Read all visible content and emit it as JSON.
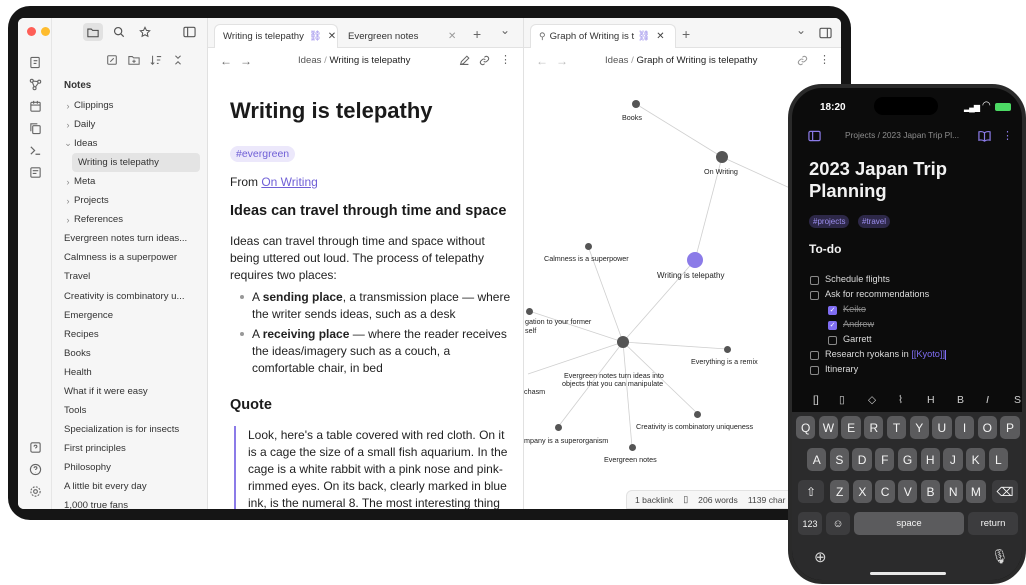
{
  "tablet": {
    "sidebar": {
      "section_title": "Notes",
      "items": [
        {
          "label": "Clippings",
          "chevron": "›"
        },
        {
          "label": "Daily",
          "chevron": "›"
        },
        {
          "label": "Ideas",
          "chevron": "⌄"
        },
        {
          "label": "Writing is telepathy",
          "chevron": ""
        },
        {
          "label": "Meta",
          "chevron": "›"
        },
        {
          "label": "Projects",
          "chevron": "›"
        },
        {
          "label": "References",
          "chevron": "›"
        },
        {
          "label": "Evergreen notes turn ideas...",
          "chevron": ""
        },
        {
          "label": "Calmness is a superpower",
          "chevron": ""
        },
        {
          "label": "Travel",
          "chevron": ""
        },
        {
          "label": "Creativity is combinatory u...",
          "chevron": ""
        },
        {
          "label": "Emergence",
          "chevron": ""
        },
        {
          "label": "Recipes",
          "chevron": ""
        },
        {
          "label": "Books",
          "chevron": ""
        },
        {
          "label": "Health",
          "chevron": ""
        },
        {
          "label": "What if it were easy",
          "chevron": ""
        },
        {
          "label": "Tools",
          "chevron": ""
        },
        {
          "label": "Specialization is for insects",
          "chevron": ""
        },
        {
          "label": "First principles",
          "chevron": ""
        },
        {
          "label": "Philosophy",
          "chevron": ""
        },
        {
          "label": "A little bit every day",
          "chevron": ""
        },
        {
          "label": "1,000 true fans",
          "chevron": ""
        }
      ]
    },
    "tabs": {
      "left": [
        {
          "label": "Writing is telepathy"
        },
        {
          "label": "Evergreen notes"
        }
      ],
      "right": [
        {
          "label": "Graph of Writing is t"
        }
      ],
      "add_symbol": "+",
      "chevron_symbol": "⌄",
      "close_symbol": "✕"
    },
    "note": {
      "breadcrumb_folder": "Ideas",
      "breadcrumb_sep": "/",
      "breadcrumb_title": "Writing is telepathy",
      "title": "Writing is telepathy",
      "tag": "#evergreen",
      "from_prefix": "From",
      "from_link": "On Writing",
      "heading1": "Ideas can travel through time and space",
      "para1_lines": [
        "Ideas can travel through time and space without",
        "being uttered out loud. The process of telepathy",
        "requires two places:"
      ],
      "bullets": [
        {
          "lead": "A",
          "bold": "sending place",
          "rest_lines": [
            ", a transmission place — where",
            "the writer sends ideas, such as a desk"
          ]
        },
        {
          "lead": "A",
          "bold": "receiving place",
          "rest_lines": [
            " — where the reader receives",
            "the ideas/imagery such as a couch, a",
            "comfortable chair, in bed"
          ]
        }
      ],
      "heading2": "Quote",
      "quote_lines": [
        "Look, here's a table covered with red cloth. On it",
        "is a cage the size of a small fish aquarium. In the",
        "cage is a white rabbit with a pink nose and pink-",
        "rimmed eyes. On its back, clearly marked in blue",
        "ink, is the numeral 8. The most interesting thing"
      ]
    },
    "graph": {
      "breadcrumb_folder": "Ideas",
      "breadcrumb_title": "Graph of Writing is telepathy",
      "nodes": {
        "books": "Books",
        "on_writing": "On Writing",
        "calmness": "Calmness is a superpower",
        "writing": "Writing is telepathy",
        "navigation": "gation to your former",
        "navigation2": "self",
        "evergreen_turn": "Evergreen notes turn ideas into",
        "evergreen_turn2": "objects that you can manipulate",
        "remix": "Everything is a remix",
        "chasm": "chasm",
        "creativity": "Creativity is combinatory uniqueness",
        "company": "mpany is a superorganism",
        "evergreen": "Evergreen notes"
      },
      "status": {
        "backlinks": "1 backlink",
        "words": "206 words",
        "chars": "1139 char"
      }
    }
  },
  "phone": {
    "time": "18:20",
    "breadcrumb": "Projects / 2023 Japan Trip Pl...",
    "title_lines": [
      "2023 Japan Trip",
      "Planning"
    ],
    "tags": [
      "#projects",
      "#travel"
    ],
    "section": "To-do",
    "todos": [
      {
        "label": "Schedule flights",
        "checked": false,
        "indent": 0,
        "strike": false
      },
      {
        "label": "Ask for recommendations",
        "checked": false,
        "indent": 0,
        "strike": false
      },
      {
        "label": "Keiko",
        "checked": true,
        "indent": 1,
        "strike": true
      },
      {
        "label": "Andrew",
        "checked": true,
        "indent": 1,
        "strike": true
      },
      {
        "label": "Garrett",
        "checked": false,
        "indent": 1,
        "strike": false
      },
      {
        "label": "Research ryokans in ",
        "link": "[[Kyoto]]",
        "checked": false,
        "indent": 0,
        "strike": false
      },
      {
        "label": "Itinerary",
        "checked": false,
        "indent": 0,
        "strike": false
      }
    ],
    "toolbar": [
      "[]",
      "H",
      "B",
      "I",
      "S"
    ],
    "keyboard": {
      "row1": [
        "Q",
        "W",
        "E",
        "R",
        "T",
        "Y",
        "U",
        "I",
        "O",
        "P"
      ],
      "row2": [
        "A",
        "S",
        "D",
        "F",
        "G",
        "H",
        "J",
        "K",
        "L"
      ],
      "row3": [
        "Z",
        "X",
        "C",
        "V",
        "B",
        "N",
        "M"
      ],
      "num_label": "123",
      "space_label": "space",
      "return_label": "return"
    },
    "accent": "#7f6df2"
  }
}
